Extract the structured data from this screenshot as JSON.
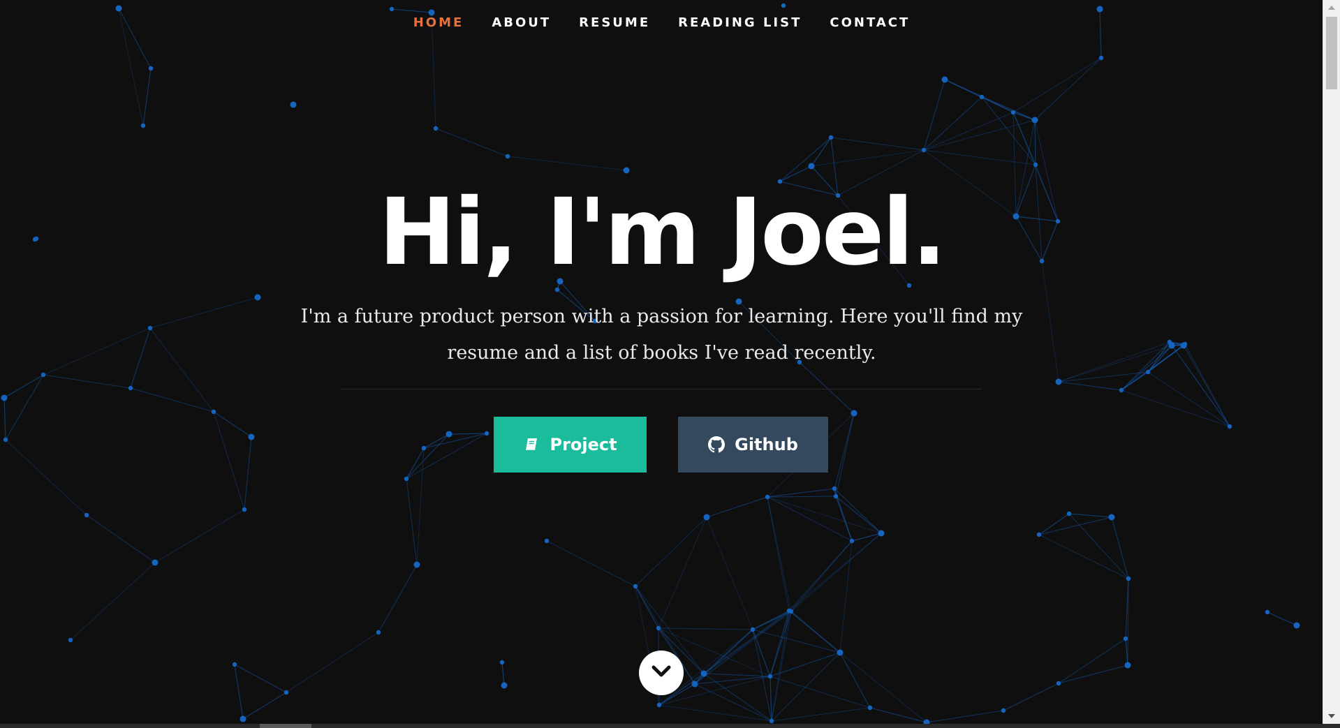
{
  "nav": {
    "items": [
      {
        "label": "HOME",
        "active": true
      },
      {
        "label": "ABOUT",
        "active": false
      },
      {
        "label": "RESUME",
        "active": false
      },
      {
        "label": "READING LIST",
        "active": false
      },
      {
        "label": "CONTACT",
        "active": false
      }
    ]
  },
  "hero": {
    "title": "Hi, I'm Joel.",
    "subtitle": "I'm a future product person with a passion for learning. Here you'll find my resume and a list of books I've read recently."
  },
  "buttons": {
    "project_label": "Project",
    "github_label": "Github"
  },
  "icons": {
    "project": "book-icon",
    "github": "github-icon",
    "scroll": "chevron-down-icon"
  },
  "colors": {
    "background": "#0f0f10",
    "nav_active": "#e8703a",
    "project_button": "#1abc9c",
    "github_button": "#34495e",
    "network": "#1565c0"
  }
}
